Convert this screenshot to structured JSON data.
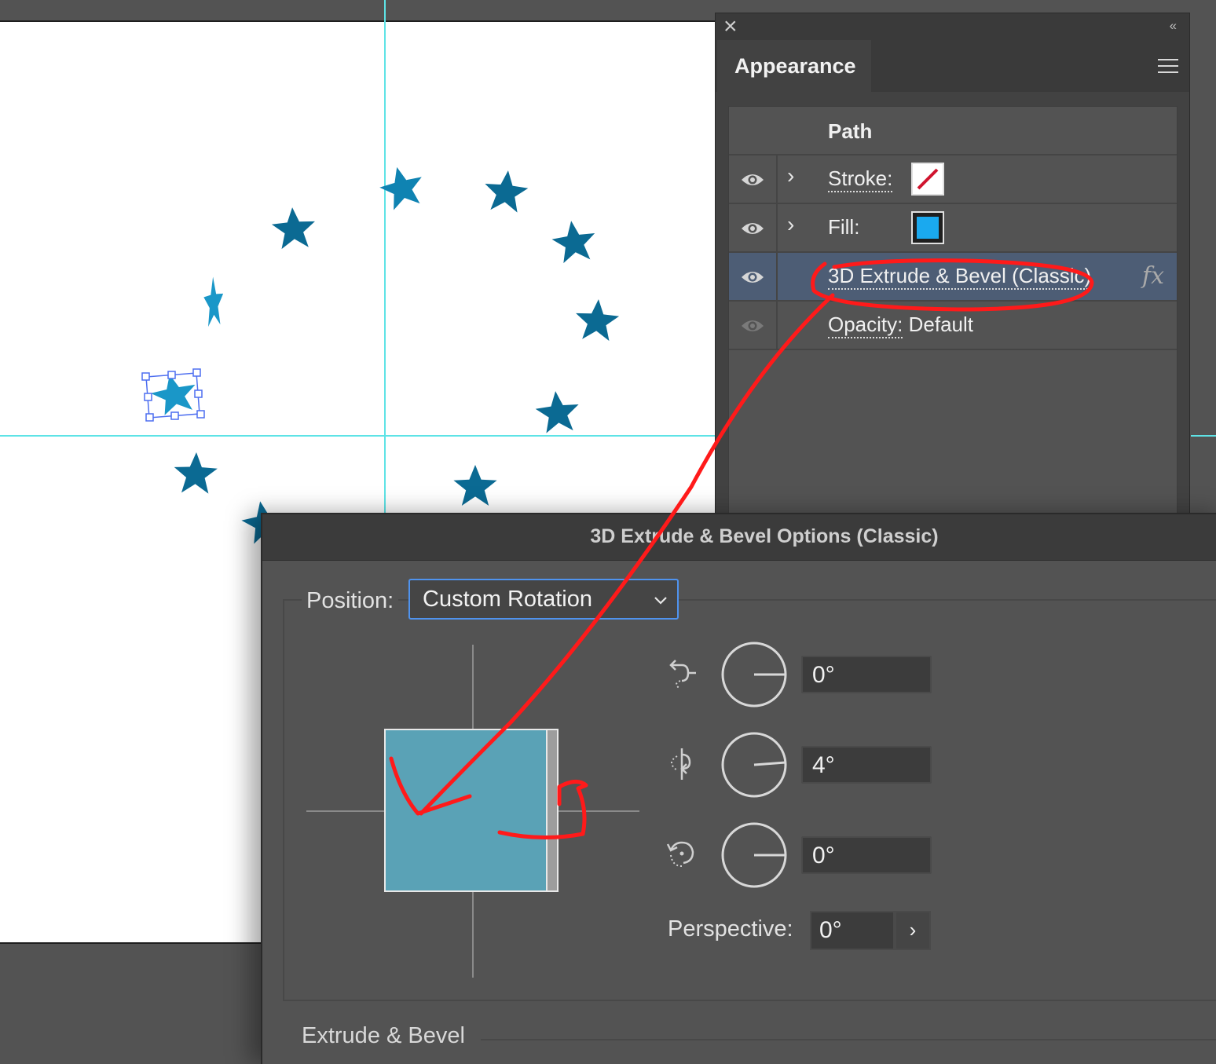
{
  "appearance_panel": {
    "close_glyph": "×",
    "collapse_glyph": "‹‹",
    "tab_label": "Appearance",
    "header": "Path",
    "rows": [
      {
        "label": "Stroke:",
        "icon": "eye-icon"
      },
      {
        "label": "Fill:",
        "icon": "eye-icon"
      },
      {
        "label": "3D Extrude & Bevel (Classic)",
        "icon": "eye-icon"
      },
      {
        "label": "Opacity:",
        "value": "Default",
        "icon": "eye-icon"
      }
    ],
    "chevron": "›",
    "fx": "fx"
  },
  "dialog": {
    "title": "3D Extrude & Bevel Options (Classic)",
    "position_label": "Position:",
    "position_value": "Custom Rotation",
    "rotation_x": "0°",
    "rotation_y": "4°",
    "rotation_z": "0°",
    "perspective_label": "Perspective:",
    "perspective_value": "0°",
    "perspective_arrow": "›",
    "extrude_label": "Extrude & Bevel"
  },
  "colors": {
    "star": "#0b6a93",
    "star_light": "#1a97c8",
    "guide": "#5ee3e6",
    "fill_swatch": "#1aa9ef",
    "stroke_none": "#d0142e",
    "annotation": "#ff1a1a",
    "preview_cube": "#5aa2b6",
    "selection": "#4d6ef0"
  },
  "icons": [
    "close-icon",
    "collapse-icon",
    "panel-menu-icon",
    "eye-icon",
    "chevron-right-icon",
    "fx-icon",
    "rotate-x-icon",
    "rotate-y-icon",
    "rotate-z-icon",
    "dial-icon",
    "chevron-down-icon"
  ]
}
